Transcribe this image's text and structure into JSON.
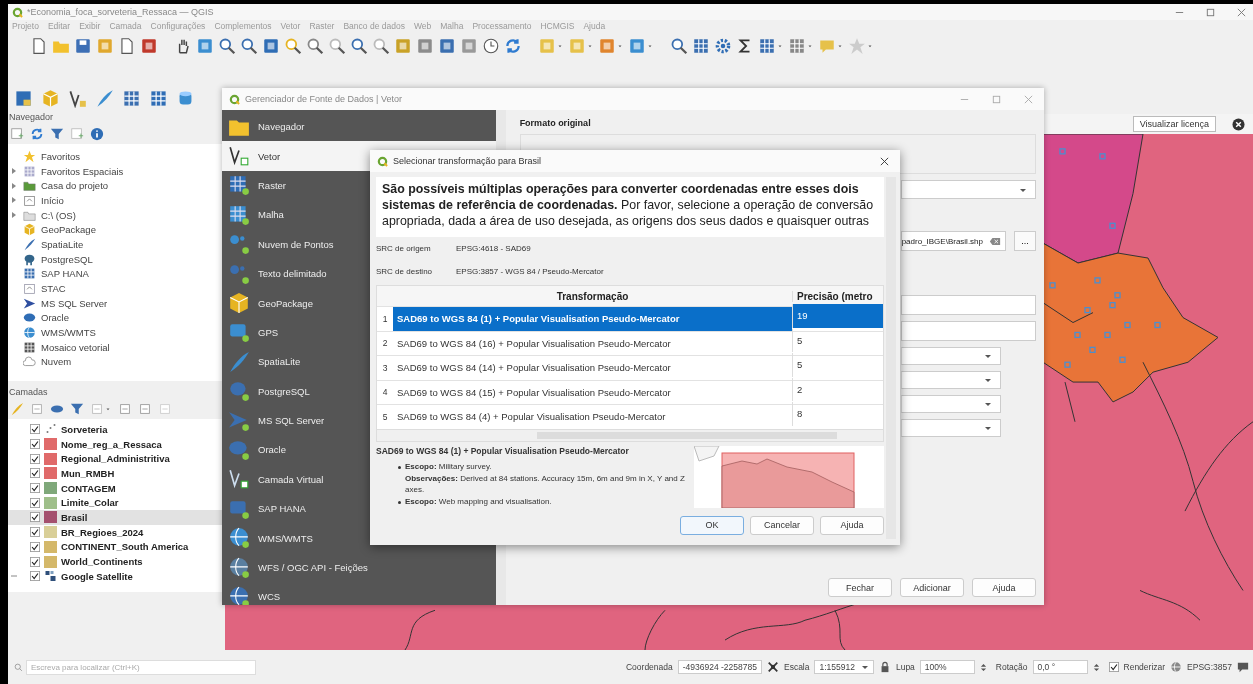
{
  "window": {
    "title": "*Economia_foca_sorveteria_Ressaca — QGIS"
  },
  "menu": [
    "Projeto",
    "Editar",
    "Exibir",
    "Camada",
    "Configurações",
    "Complementos",
    "Vetor",
    "Raster",
    "Banco de dados",
    "Web",
    "Malha",
    "Processamento",
    "HCMGIS",
    "Ajuda"
  ],
  "browser_panel": {
    "title": "Navegador",
    "items": [
      {
        "label": "Favoritos",
        "expandable": false
      },
      {
        "label": "Favoritos Espaciais",
        "expandable": true
      },
      {
        "label": "Casa do projeto",
        "expandable": true
      },
      {
        "label": "Início",
        "expandable": true
      },
      {
        "label": "C:\\ (OS)",
        "expandable": true
      },
      {
        "label": "GeoPackage",
        "expandable": false
      },
      {
        "label": "SpatiaLite",
        "expandable": false
      },
      {
        "label": "PostgreSQL",
        "expandable": false
      },
      {
        "label": "SAP HANA",
        "expandable": false
      },
      {
        "label": "STAC",
        "expandable": false
      },
      {
        "label": "MS SQL Server",
        "expandable": false
      },
      {
        "label": "Oracle",
        "expandable": false
      },
      {
        "label": "WMS/WMTS",
        "expandable": false
      },
      {
        "label": "Mosaico vetorial",
        "expandable": false
      },
      {
        "label": "Nuvem",
        "expandable": false
      }
    ]
  },
  "layers_panel": {
    "title": "Camadas",
    "items": [
      {
        "name": "Sorveteria",
        "kind": "point",
        "checked": true,
        "selected": false,
        "expandable": false
      },
      {
        "name": "Nome_reg_a_Ressaca",
        "kind": "polygon",
        "color": "#e06a6a",
        "checked": true,
        "selected": false,
        "expandable": false
      },
      {
        "name": "Regional_Administritiva",
        "kind": "polygon",
        "color": "#e06a6a",
        "checked": true,
        "selected": false,
        "expandable": false
      },
      {
        "name": "Mun_RMBH",
        "kind": "polygon",
        "color": "#e06a6a",
        "checked": true,
        "selected": false,
        "expandable": false
      },
      {
        "name": "CONTAGEM",
        "kind": "polygon",
        "color": "#7fa87a",
        "checked": true,
        "selected": false,
        "expandable": false
      },
      {
        "name": "Limite_Colar",
        "kind": "polygon",
        "color": "#9fbf8a",
        "checked": true,
        "selected": false,
        "expandable": false
      },
      {
        "name": "Brasil",
        "kind": "polygon",
        "color": "#a4506e",
        "checked": true,
        "selected": true,
        "expandable": false
      },
      {
        "name": "BR_Regioes_2024",
        "kind": "polygon",
        "color": "#d9cf98",
        "checked": true,
        "selected": false,
        "expandable": false
      },
      {
        "name": "CONTINENT_South America",
        "kind": "polygon",
        "color": "#d4b86a",
        "checked": true,
        "selected": false,
        "expandable": false
      },
      {
        "name": "World_Continents",
        "kind": "polygon",
        "color": "#d4b86a",
        "checked": true,
        "selected": false,
        "expandable": false
      },
      {
        "name": "Google Satellite",
        "kind": "raster",
        "checked": true,
        "selected": false,
        "expandable": true
      }
    ]
  },
  "map": {
    "license_button": "Visualizar licença"
  },
  "data_source_manager": {
    "title": "Gerenciador de Fonte de Dados | Vetor",
    "sidebar": [
      {
        "label": "Navegador",
        "selected": false
      },
      {
        "label": "Vetor",
        "selected": true
      },
      {
        "label": "Raster",
        "selected": false
      },
      {
        "label": "Malha",
        "selected": false
      },
      {
        "label": "Nuvem de Pontos",
        "selected": false
      },
      {
        "label": "Texto delimitado",
        "selected": false
      },
      {
        "label": "GeoPackage",
        "selected": false
      },
      {
        "label": "GPS",
        "selected": false
      },
      {
        "label": "SpatiaLite",
        "selected": false
      },
      {
        "label": "PostgreSQL",
        "selected": false
      },
      {
        "label": "MS SQL Server",
        "selected": false
      },
      {
        "label": "Oracle",
        "selected": false
      },
      {
        "label": "Camada Virtual",
        "selected": false
      },
      {
        "label": "SAP HANA",
        "selected": false
      },
      {
        "label": "WMS/WMTS",
        "selected": false
      },
      {
        "label": "WFS / OGC API - Feições",
        "selected": false
      },
      {
        "label": "WCS",
        "selected": false
      }
    ],
    "section_title": "Formato original",
    "file_path": "padro_IBGE\\Brasil.shp",
    "browse_button": "...",
    "buttons": [
      "Fechar",
      "Adicionar",
      "Ajuda"
    ]
  },
  "transform_dialog": {
    "title": "Selecionar transformação para Brasil",
    "message": "**São possíveis múltiplas operações para converter coordenadas entre esses dois sistemas de referência de coordenadas.** Por favor, selecione a operação de conversão apropriada, dada a área de uso desejada, as origens dos seus dados e quaisquer outras",
    "source_crs_label": "SRC de origem",
    "source_crs": "EPSG:4618 - SAD69",
    "dest_crs_label": "SRC de destino",
    "dest_crs": "EPSG:3857 - WGS 84 / Pseudo-Mercator",
    "columns": [
      "Transformação",
      "Precisão (metro"
    ],
    "rows": [
      {
        "number": "1",
        "transformation": "SAD69 to WGS 84 (1) + Popular Visualisation Pseudo-Mercator",
        "accuracy": "19",
        "selected": true
      },
      {
        "number": "2",
        "transformation": "SAD69 to WGS 84 (16) + Popular Visualisation Pseudo-Mercator",
        "accuracy": "5",
        "selected": false
      },
      {
        "number": "3",
        "transformation": "SAD69 to WGS 84 (14) + Popular Visualisation Pseudo-Mercator",
        "accuracy": "5",
        "selected": false
      },
      {
        "number": "4",
        "transformation": "SAD69 to WGS 84 (15) + Popular Visualisation Pseudo-Mercator",
        "accuracy": "2",
        "selected": false
      },
      {
        "number": "5",
        "transformation": "SAD69 to WGS 84 (4) + Popular Visualisation Pseudo-Mercator",
        "accuracy": "8",
        "selected": false
      }
    ],
    "details_title": "SAD69 to WGS 84 (1) + Popular Visualisation Pseudo-Mercator",
    "details": [
      {
        "bullet": true,
        "text": "**Escopo:** Military survey."
      },
      {
        "bullet": false,
        "text": "**Observações:** Derived at 84 stations. Accuracy 15m, 6m and 9m in X, Y and Z axes."
      },
      {
        "bullet": true,
        "text": "**Escopo:** Web mapping and visualisation."
      }
    ],
    "buttons": [
      "OK",
      "Cancelar",
      "Ajuda"
    ]
  },
  "status_bar": {
    "search_placeholder": "Escreva para localizar (Ctrl+K)",
    "coordinate_label": "Coordenada",
    "coordinate": "-4936924 -2258785",
    "scale_label": "Escala",
    "scale": "1:155912",
    "magnifier_label": "Lupa",
    "magnifier": "100%",
    "rotation_label": "Rotação",
    "rotation": "0,0 °",
    "render_label": "Renderizar",
    "render_checked": true,
    "crs": "EPSG:3857"
  }
}
